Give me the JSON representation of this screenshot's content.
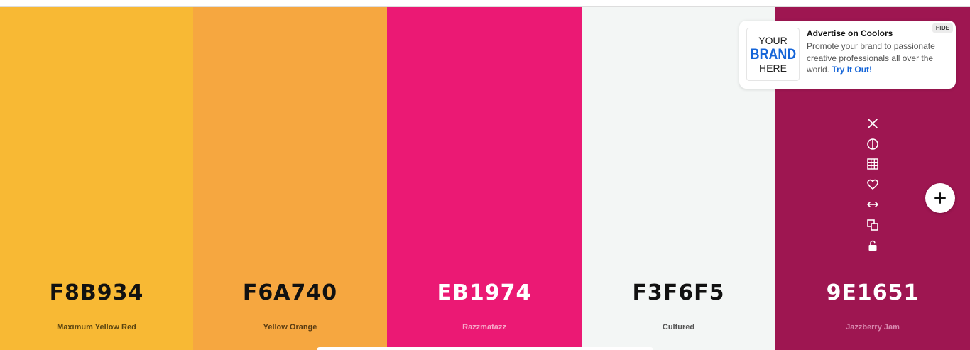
{
  "palette": {
    "colors": [
      {
        "hex": "F8B934",
        "name": "Maximum Yellow Red",
        "bg": "#F8B934",
        "hex_color": "#111111",
        "name_color": "#5a4410"
      },
      {
        "hex": "F6A740",
        "name": "Yellow Orange",
        "bg": "#F6A740",
        "hex_color": "#111111",
        "name_color": "#5a3c12"
      },
      {
        "hex": "EB1974",
        "name": "Razzmatazz",
        "bg": "#EB1974",
        "hex_color": "#ffffff",
        "name_color": "#f7a9c9"
      },
      {
        "hex": "F3F6F5",
        "name": "Cultured",
        "bg": "#F3F6F5",
        "hex_color": "#111111",
        "name_color": "#555555"
      },
      {
        "hex": "9E1651",
        "name": "Jazzberry Jam",
        "bg": "#9E1651",
        "hex_color": "#ffffff",
        "name_color": "#d98ab0"
      }
    ]
  },
  "toolbar": {
    "icons": [
      "close-icon",
      "contrast-icon",
      "grid-icon",
      "heart-icon",
      "drag-horizontal-icon",
      "copy-icon",
      "unlock-icon"
    ]
  },
  "add_button": {
    "icon": "plus-icon"
  },
  "ad": {
    "logo": {
      "line1": "YOUR",
      "line2": "BRAND",
      "line3": "HERE"
    },
    "title": "Advertise on Coolors",
    "description": "Promote your brand to passionate creative professionals all over the world.",
    "link": "Try It Out!",
    "hide": "HIDE"
  }
}
